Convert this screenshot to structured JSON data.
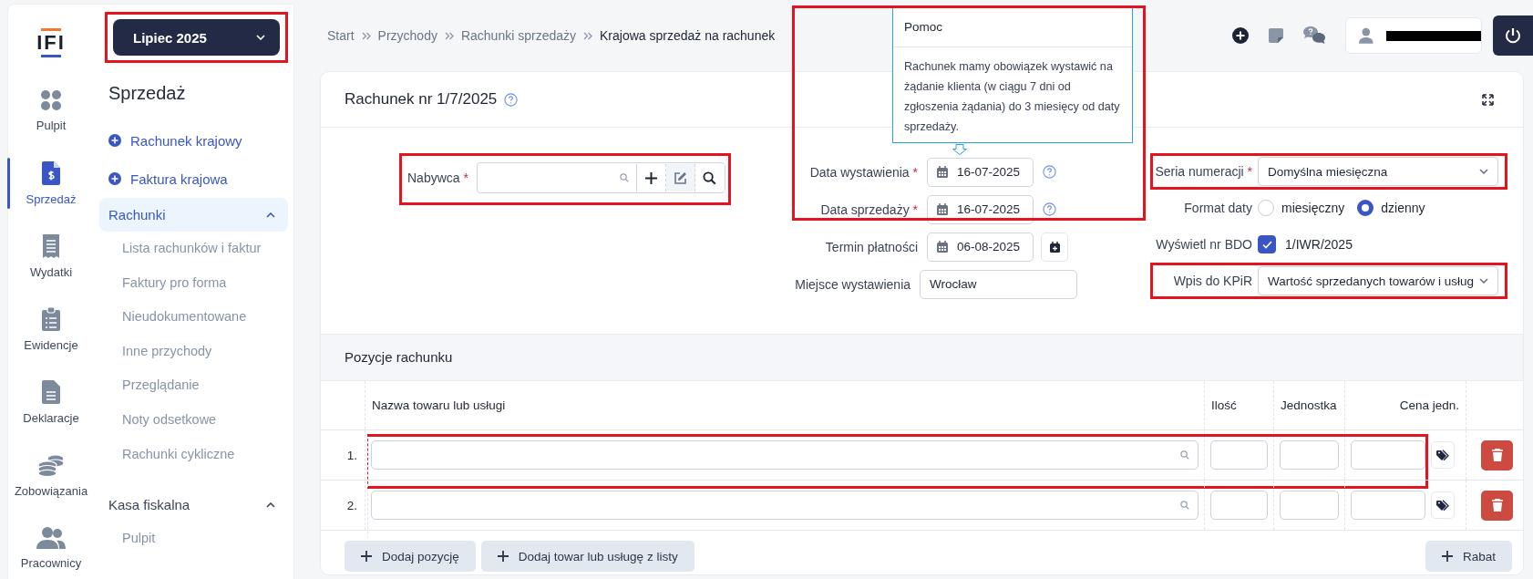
{
  "rail": {
    "logo": "IFI",
    "items": [
      {
        "label": "Pulpit",
        "selected": false
      },
      {
        "label": "Sprzedaż",
        "selected": true
      },
      {
        "label": "Wydatki",
        "selected": false
      },
      {
        "label": "Ewidencje",
        "selected": false
      },
      {
        "label": "Deklaracje",
        "selected": false
      },
      {
        "label": "Zobowiązania",
        "selected": false
      },
      {
        "label": "Pracownicy",
        "selected": false
      }
    ]
  },
  "period_button": {
    "label": "Lipiec 2025",
    "highlighted": true
  },
  "nav": {
    "title": "Sprzedaż",
    "actions": [
      "Rachunek krajowy",
      "Faktura krajowa"
    ],
    "groups": [
      {
        "label": "Rachunki",
        "selected": true,
        "expanded": true,
        "items": [
          "Lista rachunków i faktur",
          "Faktury pro forma",
          "Nieudokumentowane",
          "Inne przychody",
          "Przeglądanie",
          "Noty odsetkowe",
          "Rachunki cykliczne"
        ]
      },
      {
        "label": "Kasa fiskalna",
        "selected": false,
        "expanded": true,
        "items": [
          "Pulpit"
        ]
      }
    ]
  },
  "breadcrumb": [
    "Start",
    "Przychody",
    "Rachunki sprzedaży",
    "Krajowa sprzedaż na rachunek"
  ],
  "document": {
    "title": "Rachunek nr 1/7/2025"
  },
  "help_popup": {
    "title": "Pomoc",
    "text": "Rachunek mamy obowiązek wystawić na żądanie klienta (w ciągu 7 dni od zgłoszenia żądania) do 3 miesięcy od daty sprzedaży.",
    "highlighted": true
  },
  "buyer": {
    "label": "Nabywca",
    "required_mark": "*",
    "highlighted": true
  },
  "date_fields": [
    {
      "kind": "date",
      "label": "Data wystawienia",
      "required_mark": "*",
      "value": "16-07-2025",
      "help": true
    },
    {
      "kind": "date",
      "label": "Data sprzedaży",
      "required_mark": "*",
      "value": "16-07-2025",
      "help": true
    },
    {
      "kind": "date",
      "label": "Termin płatności",
      "value": "06-08-2025",
      "calendar_button": true
    },
    {
      "kind": "text",
      "label": "Miejsce wystawienia",
      "value": "Wrocław"
    }
  ],
  "settings": [
    {
      "kind": "select",
      "label": "Seria numeracji",
      "required_mark": "*",
      "value": "Domyślna miesięczna",
      "highlighted": true
    },
    {
      "kind": "radio",
      "label": "Format daty",
      "options": [
        {
          "label": "miesięczny",
          "selected": false
        },
        {
          "label": "dzienny",
          "selected": true
        }
      ]
    },
    {
      "kind": "checkbox",
      "label": "Wyświetl nr BDO",
      "checked": true,
      "value": "1/IWR/2025"
    },
    {
      "kind": "select",
      "label": "Wpis do KPiR",
      "value": "Wartość sprzedanych towarów i usług",
      "highlighted": true
    }
  ],
  "items": {
    "title": "Pozycje rachunku",
    "columns": [
      "Nazwa towaru lub usługi",
      "Ilość",
      "Jednostka",
      "Cena jedn."
    ],
    "rows": [
      {
        "number": "1.",
        "highlighted": true
      },
      {
        "number": "2.",
        "highlighted": false
      }
    ],
    "add_buttons": [
      "Dodaj pozycję",
      "Dodaj towar lub usługę z listy"
    ],
    "discount_button": "Rabat"
  }
}
